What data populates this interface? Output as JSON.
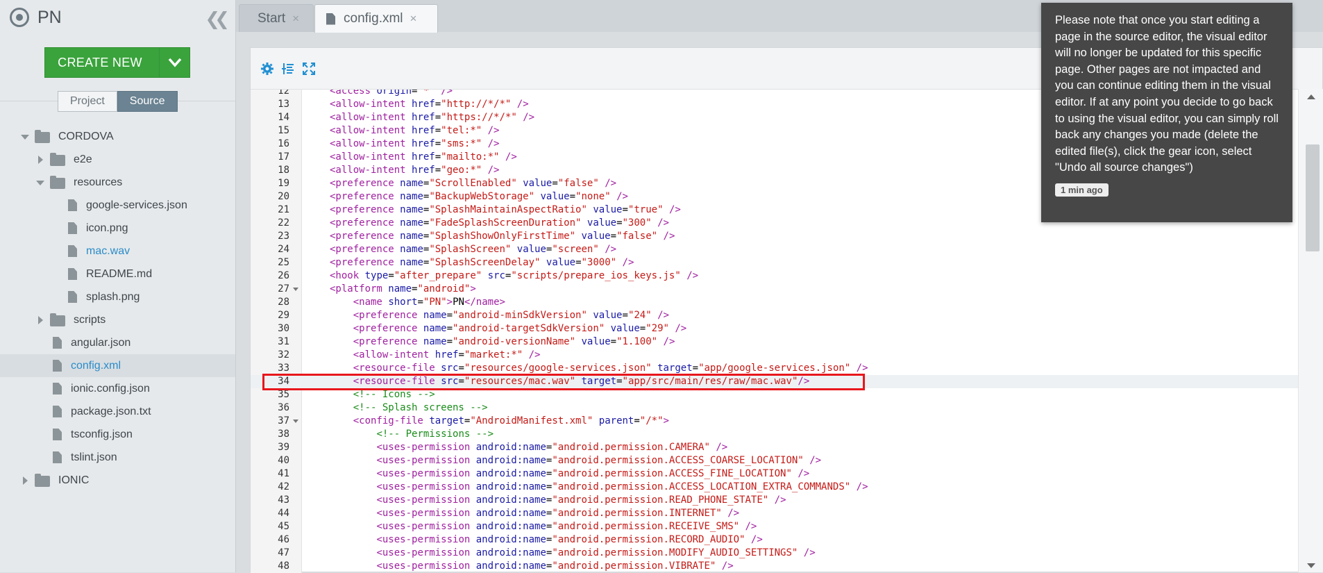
{
  "app": {
    "name": "PN"
  },
  "sidebar": {
    "create_label": "CREATE NEW",
    "mode_tabs": [
      {
        "label": "Project",
        "active": false
      },
      {
        "label": "Source",
        "active": true
      }
    ],
    "tree": [
      {
        "label": "CORDOVA",
        "type": "folder",
        "state": "expanded"
      },
      {
        "label": "e2e",
        "type": "folder",
        "state": "collapsed"
      },
      {
        "label": "resources",
        "type": "folder",
        "state": "expanded"
      },
      {
        "label": "google-services.json",
        "type": "file"
      },
      {
        "label": "icon.png",
        "type": "file"
      },
      {
        "label": "mac.wav",
        "type": "file",
        "link": true
      },
      {
        "label": "README.md",
        "type": "file"
      },
      {
        "label": "splash.png",
        "type": "file"
      },
      {
        "label": "scripts",
        "type": "folder",
        "state": "collapsed"
      },
      {
        "label": "angular.json",
        "type": "file"
      },
      {
        "label": "config.xml",
        "type": "file",
        "selected": true,
        "link": true
      },
      {
        "label": "ionic.config.json",
        "type": "file"
      },
      {
        "label": "package.json.txt",
        "type": "file"
      },
      {
        "label": "tsconfig.json",
        "type": "file"
      },
      {
        "label": "tslint.json",
        "type": "file"
      },
      {
        "label": "IONIC",
        "type": "folder",
        "state": "collapsed"
      }
    ]
  },
  "tabs": [
    {
      "label": "Start",
      "close": "×",
      "active": false
    },
    {
      "label": "config.xml",
      "close": "×",
      "active": true
    }
  ],
  "editor": {
    "current_line": 34,
    "lines": [
      {
        "n": "12",
        "html": "<span class=\"t\">&lt;access</span> <span class=\"a\">origin</span>=<span class=\"v\">\"*\"</span> <span class=\"t\">/&gt;</span>",
        "text": "<access origin=\"*\" />"
      },
      {
        "n": "13",
        "text": "<allow-intent href=\"http://*/*\" />"
      },
      {
        "n": "14",
        "text": "<allow-intent href=\"https://*/*\" />"
      },
      {
        "n": "15",
        "text": "<allow-intent href=\"tel:*\" />"
      },
      {
        "n": "16",
        "text": "<allow-intent href=\"sms:*\" />"
      },
      {
        "n": "17",
        "text": "<allow-intent href=\"mailto:*\" />"
      },
      {
        "n": "18",
        "text": "<allow-intent href=\"geo:*\" />"
      },
      {
        "n": "19",
        "text": "<preference name=\"ScrollEnabled\" value=\"false\" />"
      },
      {
        "n": "20",
        "text": "<preference name=\"BackupWebStorage\" value=\"none\" />"
      },
      {
        "n": "21",
        "text": "<preference name=\"SplashMaintainAspectRatio\" value=\"true\" />"
      },
      {
        "n": "22",
        "text": "<preference name=\"FadeSplashScreenDuration\" value=\"300\" />"
      },
      {
        "n": "23",
        "text": "<preference name=\"SplashShowOnlyFirstTime\" value=\"false\" />"
      },
      {
        "n": "24",
        "text": "<preference name=\"SplashScreen\" value=\"screen\" />"
      },
      {
        "n": "25",
        "text": "<preference name=\"SplashScreenDelay\" value=\"3000\" />"
      },
      {
        "n": "26",
        "text": "<hook type=\"after_prepare\" src=\"scripts/prepare_ios_keys.js\" />"
      },
      {
        "n": "27",
        "text": "<platform name=\"android\">",
        "fold": true
      },
      {
        "n": "28",
        "text": "    <name short=\"PN\">PN</name>"
      },
      {
        "n": "29",
        "text": "    <preference name=\"android-minSdkVersion\" value=\"24\" />"
      },
      {
        "n": "30",
        "text": "    <preference name=\"android-targetSdkVersion\" value=\"29\" />"
      },
      {
        "n": "31",
        "text": "    <preference name=\"android-versionName\" value=\"1.100\" />"
      },
      {
        "n": "32",
        "text": "    <allow-intent href=\"market:*\" />"
      },
      {
        "n": "33",
        "text": "    <resource-file src=\"resources/google-services.json\" target=\"app/google-services.json\" />"
      },
      {
        "n": "34",
        "text": "    <resource-file src=\"resources/mac.wav\" target=\"app/src/main/res/raw/mac.wav\"/>"
      },
      {
        "n": "35",
        "text": "    <!-- Icons -->"
      },
      {
        "n": "36",
        "text": "    <!-- Splash screens -->"
      },
      {
        "n": "37",
        "text": "    <config-file target=\"AndroidManifest.xml\" parent=\"/*\">",
        "fold": true
      },
      {
        "n": "38",
        "text": "        <!-- Permissions -->"
      },
      {
        "n": "39",
        "text": "        <uses-permission android:name=\"android.permission.CAMERA\" />"
      },
      {
        "n": "40",
        "text": "        <uses-permission android:name=\"android.permission.ACCESS_COARSE_LOCATION\" />"
      },
      {
        "n": "41",
        "text": "        <uses-permission android:name=\"android.permission.ACCESS_FINE_LOCATION\" />"
      },
      {
        "n": "42",
        "text": "        <uses-permission android:name=\"android.permission.ACCESS_LOCATION_EXTRA_COMMANDS\" />"
      },
      {
        "n": "43",
        "text": "        <uses-permission android:name=\"android.permission.READ_PHONE_STATE\" />"
      },
      {
        "n": "44",
        "text": "        <uses-permission android:name=\"android.permission.INTERNET\" />"
      },
      {
        "n": "45",
        "text": "        <uses-permission android:name=\"android.permission.RECEIVE_SMS\" />"
      },
      {
        "n": "46",
        "text": "        <uses-permission android:name=\"android.permission.RECORD_AUDIO\" />"
      },
      {
        "n": "47",
        "text": "        <uses-permission android:name=\"android.permission.MODIFY_AUDIO_SETTINGS\" />"
      },
      {
        "n": "48",
        "text": "        <uses-permission android:name=\"android.permission.VIBRATE\" />"
      }
    ]
  },
  "toast": {
    "message": "Please note that once you start editing a page in the source editor, the visual editor will no longer be updated for this specific page. Other pages are not impacted and you can continue editing them in the visual editor. If at any point you decide to go back to using the visual editor, you can simply roll back any changes you made (delete the edited file(s), click the gear icon, select \"Undo all source changes\")",
    "time": "1 min ago"
  },
  "colors": {
    "create_button": "#3aa33c",
    "active_mode_tab": "#6b8392",
    "xml_tag": "#a020a0",
    "xml_attribute": "#1a1aa6",
    "xml_value": "#c41a16",
    "xml_comment": "#1a8c1a",
    "highlight_box": "#e8161c",
    "link_text": "#2a8cc9"
  },
  "icons": {
    "toolbar": [
      "gear-icon",
      "indent-icon",
      "fullscreen-icon"
    ]
  }
}
